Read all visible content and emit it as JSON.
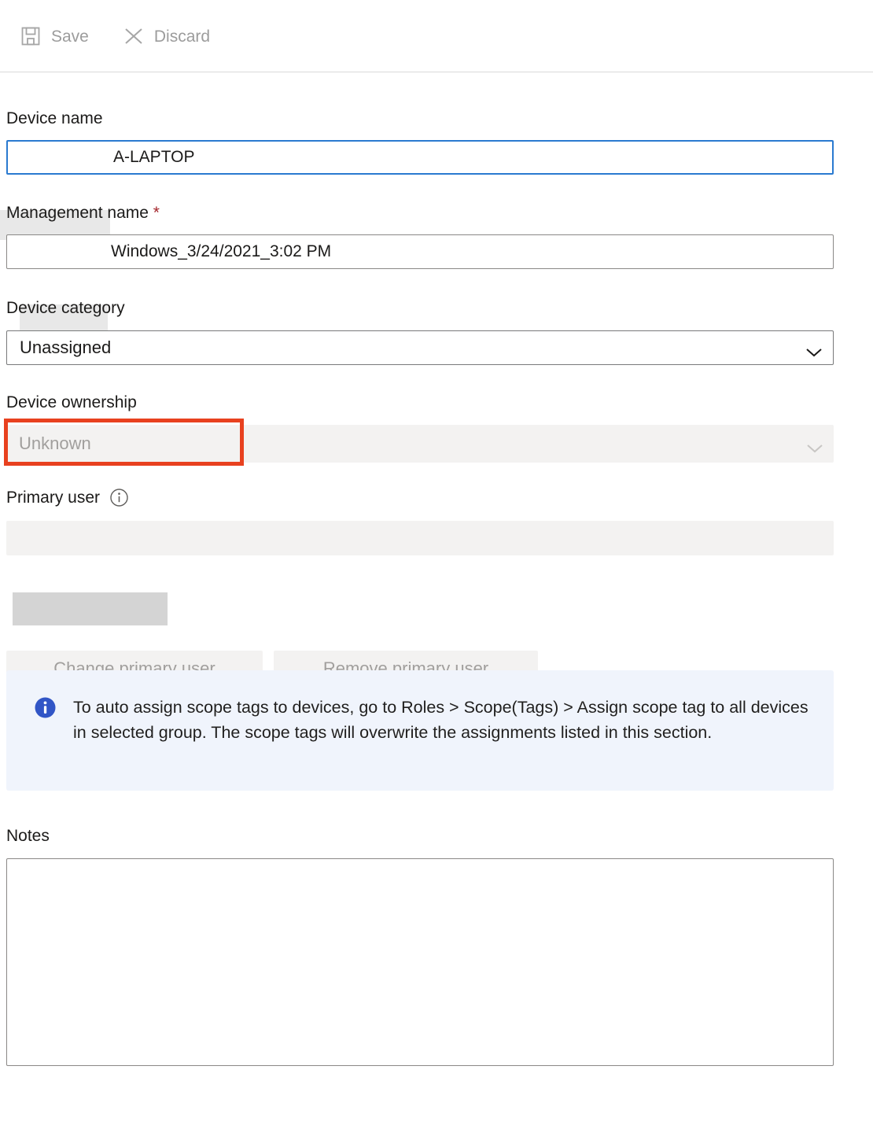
{
  "toolbar": {
    "save": {
      "label": "Save",
      "icon": "save-floppy-icon",
      "enabled": false
    },
    "discard": {
      "label": "Discard",
      "icon": "close-x-icon",
      "enabled": false
    }
  },
  "form": {
    "device_name": {
      "label": "Device name",
      "value": "A-LAPTOP",
      "redacted": true,
      "focused": true
    },
    "management_name": {
      "label": "Management name",
      "required_marker": "*",
      "value": "Windows_3/24/2021_3:02 PM",
      "redacted": true
    },
    "device_category": {
      "label": "Device category",
      "value": "Unassigned",
      "icon": "chevron-down-icon",
      "enabled": true
    },
    "device_ownership": {
      "label": "Device ownership",
      "value": "Unknown",
      "icon": "chevron-down-icon",
      "enabled": false,
      "highlighted": true
    },
    "primary_user": {
      "label": "Primary user",
      "info_icon": "info-circle-icon",
      "value": "",
      "redacted": true,
      "enabled": false,
      "change_button": "Change primary user",
      "remove_button": "Remove primary user"
    },
    "notes": {
      "label": "Notes",
      "value": "",
      "placeholder": ""
    }
  },
  "banner": {
    "icon": "info-circle-filled-icon",
    "text": "To auto assign scope tags to devices, go to Roles > Scope(Tags) > Assign scope tag to all devices in selected group. The scope tags will overwrite the assignments listed in this section."
  },
  "colors": {
    "focus_blue": "#2a7ad0",
    "annotation_red": "#e8411f",
    "required_red": "#a4262c",
    "banner_bg": "#f0f4fc",
    "banner_icon_blue": "#3155c6",
    "disabled_bg": "#f3f2f1",
    "disabled_text": "#a19f9d"
  }
}
